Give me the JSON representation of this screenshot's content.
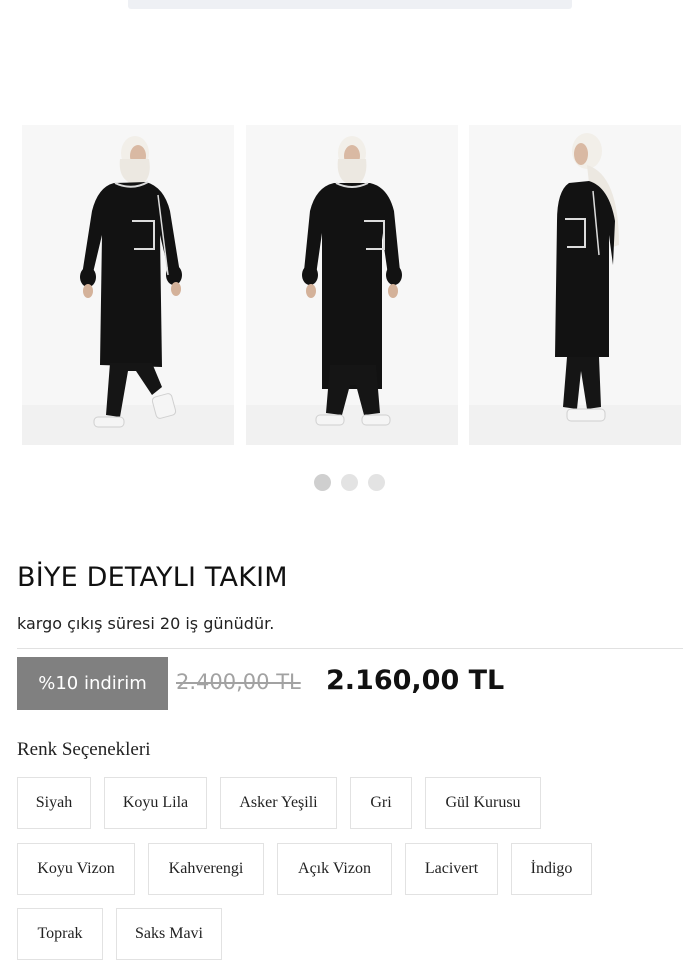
{
  "gallery": {
    "images": [
      {
        "alt": "product-photo-front-left"
      },
      {
        "alt": "product-photo-front"
      },
      {
        "alt": "product-photo-side"
      }
    ],
    "active_index": 0,
    "dot_count": 3
  },
  "product": {
    "title": "BİYE DETAYLI TAKIM",
    "shipping_note": "kargo çıkış süresi 20 iş günüdür.",
    "discount_badge": "%10 indirim",
    "old_price": "2.400,00 TL",
    "new_price": "2.160,00 TL"
  },
  "colors": {
    "title": "Renk Seçenekleri",
    "options": [
      "Siyah",
      "Koyu Lila",
      "Asker Yeşili",
      "Gri",
      "Gül Kurusu",
      "Koyu Vizon",
      "Kahverengi",
      "Açık Vizon",
      "Lacivert",
      "İndigo",
      "Toprak",
      "Saks Mavi"
    ]
  },
  "theme": {
    "badge_bg": "#808080",
    "price_old": "#a2a2a2",
    "garment": "#111111",
    "hijab": "#f2efe9"
  }
}
